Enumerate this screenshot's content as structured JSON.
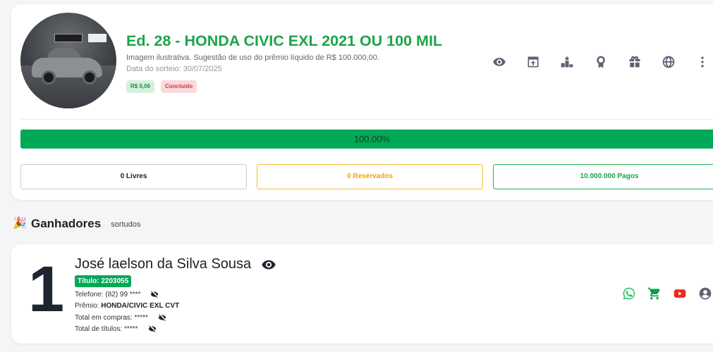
{
  "raffle": {
    "title": "Ed. 28 - HONDA CIVIC EXL 2021 OU 100 MIL",
    "subtitle": "Imagem ilustrativa. Sugestão de uso do prêmio líquido de R$ 100.000,00.",
    "draw_date": "Data do sorteio: 30/07/2025",
    "price_badge": "R$ 0,06",
    "status_badge": "Concluído",
    "progress_label": "100.00%",
    "progress_value": 1.0,
    "stats": {
      "free": "0 Livres",
      "reserved": "0 Reservados",
      "paid": "10.000.000 Pagos"
    },
    "toolbar_icons": [
      "eye-icon",
      "share-icon",
      "podium-icon",
      "award-icon",
      "gift-icon",
      "ball-icon",
      "more-vertical-icon"
    ]
  },
  "winners_section": {
    "title": "Ganhadores",
    "subtitle": "sortudos",
    "icon": "party-popper-icon"
  },
  "winner": {
    "rank": "1",
    "name": "José laelson da Silva Sousa",
    "ticket": "Título: 2203055",
    "phone_label": "Telefone: (82) 99 ****",
    "prize_label": "Prêmio:",
    "prize_value": "HONDA/CIVIC EXL CVT",
    "total_purchases": "Total em compras: *****",
    "total_tickets": "Total de títulos: *****",
    "actions": [
      "whatsapp-icon",
      "cart-icon",
      "youtube-icon",
      "user-icon"
    ]
  },
  "colors": {
    "brand_green": "#1ea34a",
    "progress_green": "#00a957",
    "reserved_yellow": "#f0a500",
    "status_red": "#d9303f"
  }
}
